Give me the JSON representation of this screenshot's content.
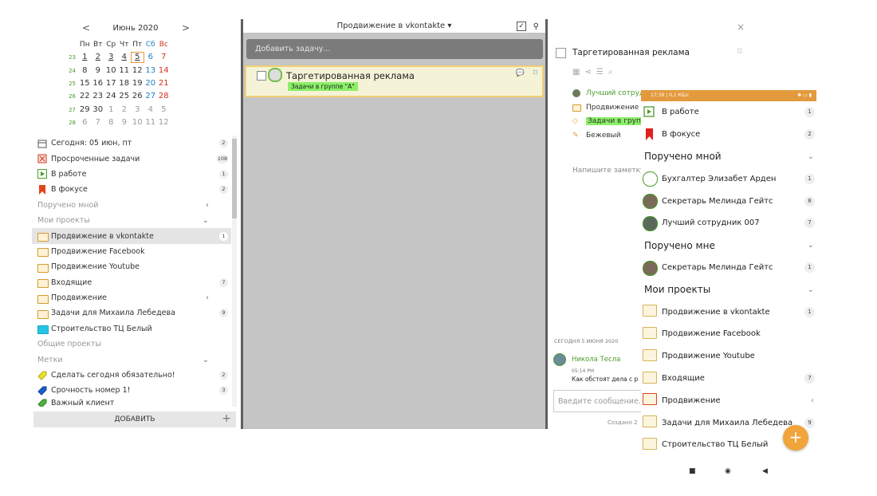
{
  "calendar": {
    "month": "Июнь 2020",
    "prev": "<",
    "next": ">",
    "weekdays": [
      "Пн",
      "Вт",
      "Ср",
      "Чт",
      "Пт",
      "Сб",
      "Вс"
    ],
    "weeks": [
      {
        "num": "23",
        "days": [
          "1",
          "2",
          "3",
          "4",
          "5",
          "6",
          "7"
        ]
      },
      {
        "num": "24",
        "days": [
          "8",
          "9",
          "10",
          "11",
          "12",
          "13",
          "14"
        ]
      },
      {
        "num": "25",
        "days": [
          "15",
          "16",
          "17",
          "18",
          "19",
          "20",
          "21"
        ]
      },
      {
        "num": "26",
        "days": [
          "22",
          "23",
          "24",
          "25",
          "26",
          "27",
          "28"
        ]
      },
      {
        "num": "27",
        "days": [
          "29",
          "30",
          "1",
          "2",
          "3",
          "4",
          "5"
        ]
      },
      {
        "num": "28",
        "days": [
          "6",
          "7",
          "8",
          "9",
          "10",
          "11",
          "12"
        ]
      }
    ]
  },
  "sidebar": {
    "items": [
      {
        "label": "Сегодня: 05 июн, пт",
        "count": "2"
      },
      {
        "label": "Просроченные задачи",
        "count": "108"
      },
      {
        "label": "В работе",
        "count": "1"
      },
      {
        "label": "В фокусе",
        "count": "2"
      },
      {
        "label": "Поручено мной"
      },
      {
        "label": "Мои проекты"
      },
      {
        "label": "Продвижение в vkontakte",
        "count": "1"
      },
      {
        "label": "Продвижение Facebook"
      },
      {
        "label": "Продвижение Youtube"
      },
      {
        "label": "Входящие",
        "count": "7"
      },
      {
        "label": "Продвижение"
      },
      {
        "label": "Задачи для Михаила Лебедева",
        "count": "9"
      },
      {
        "label": "Строительство ТЦ Белый"
      },
      {
        "label": "Общие проекты"
      },
      {
        "label": "Метки"
      },
      {
        "label": "Сделать сегодня обязательно!",
        "count": "2"
      },
      {
        "label": "Срочность номер 1!",
        "count": "3"
      },
      {
        "label": "Важный клиент"
      }
    ],
    "add_label": "ДОБАВИТЬ",
    "add_plus": "+"
  },
  "middle": {
    "project_title": "Продвижение в vkontakte",
    "add_task_placeholder": "Добавить задачу...",
    "task": {
      "title": "Таргетированная реклама",
      "tag": "Задачи в группе \"А\""
    }
  },
  "detail": {
    "close": "×",
    "title": "Таргетированная реклама",
    "assignee": "Лучший сотруд",
    "project": "Продвижение",
    "tag": "Задачи в груп",
    "color": "Бежевый",
    "note_placeholder": "Напишите заметку",
    "date": "СЕГОДНЯ 5 ИЮНЯ 2020",
    "comment_user": "Никола Тесла",
    "comment_time": "05:14 PM",
    "comment_text": "Как обстоят дела с р",
    "message_placeholder": "Введите сообщение...",
    "created": "Создано 2"
  },
  "phone": {
    "status_left": "17:39 | 0,1 КБ/с",
    "items": [
      {
        "label": "В работе",
        "count": "1"
      },
      {
        "label": "В фокусе",
        "count": "2"
      },
      {
        "label": "Поручено мной"
      },
      {
        "label": "Бухгалтер Элизабет Арден",
        "count": "1"
      },
      {
        "label": "Секретарь Мелинда Гейтс",
        "count": "8"
      },
      {
        "label": "Лучший сотрудник 007",
        "count": "7"
      },
      {
        "label": "Поручено мне"
      },
      {
        "label": "Секретарь Мелинда Гейтс",
        "count": "1"
      },
      {
        "label": "Мои проекты"
      },
      {
        "label": "Продвижение в vkontakte",
        "count": "1"
      },
      {
        "label": "Продвижение Facebook"
      },
      {
        "label": "Продвижение Youtube"
      },
      {
        "label": "Входящие",
        "count": "7"
      },
      {
        "label": "Продвижение"
      },
      {
        "label": "Задачи для Михаила Лебедева",
        "count": "9"
      },
      {
        "label": "Строительство ТЦ Белый"
      }
    ],
    "fab": "+"
  },
  "colors": {
    "accent": "#e39a3c",
    "tag_green": "#8af067",
    "task_bg": "#f5f3d7",
    "green": "#4a9b2a"
  }
}
